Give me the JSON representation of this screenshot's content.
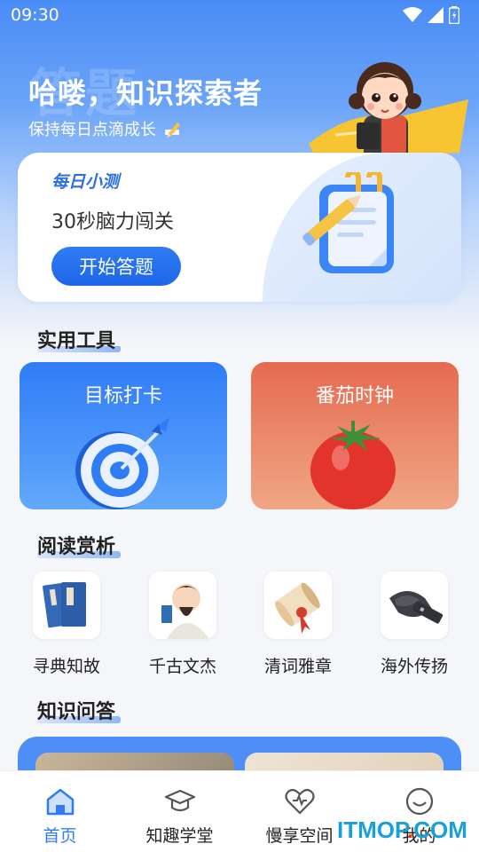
{
  "status_bar": {
    "time": "09:30"
  },
  "hero": {
    "watermark": "答题",
    "title": "哈喽，知识探索者",
    "subtitle": "保持每日点滴成长"
  },
  "daily_quiz": {
    "tag": "每日小测",
    "text": "30秒脑力闯关",
    "button": "开始答题"
  },
  "sections": {
    "tools": "实用工具",
    "reading": "阅读赏析",
    "qa": "知识问答"
  },
  "tools": [
    {
      "label": "目标打卡",
      "icon": "target-icon"
    },
    {
      "label": "番茄时钟",
      "icon": "tomato-icon"
    }
  ],
  "reading": [
    {
      "label": "寻典知故",
      "icon": "books-icon"
    },
    {
      "label": "千古文杰",
      "icon": "scholar-icon"
    },
    {
      "label": "清词雅章",
      "icon": "scroll-icon"
    },
    {
      "label": "海外传扬",
      "icon": "inkstone-icon"
    }
  ],
  "tabbar": [
    {
      "label": "首页",
      "icon": "home-icon",
      "active": true
    },
    {
      "label": "知趣学堂",
      "icon": "graduation-cap-icon",
      "active": false
    },
    {
      "label": "慢享空间",
      "icon": "heart-icon",
      "active": false
    },
    {
      "label": "我的",
      "icon": "smiley-icon",
      "active": false
    }
  ],
  "colors": {
    "primary": "#2f7cf5",
    "tool_goal": "#2f7cf7",
    "tool_tomato": "#e56a50"
  },
  "watermark_logo": {
    "it": "IT",
    "mop": "MOP",
    "dot": ".",
    "com": "COM"
  }
}
